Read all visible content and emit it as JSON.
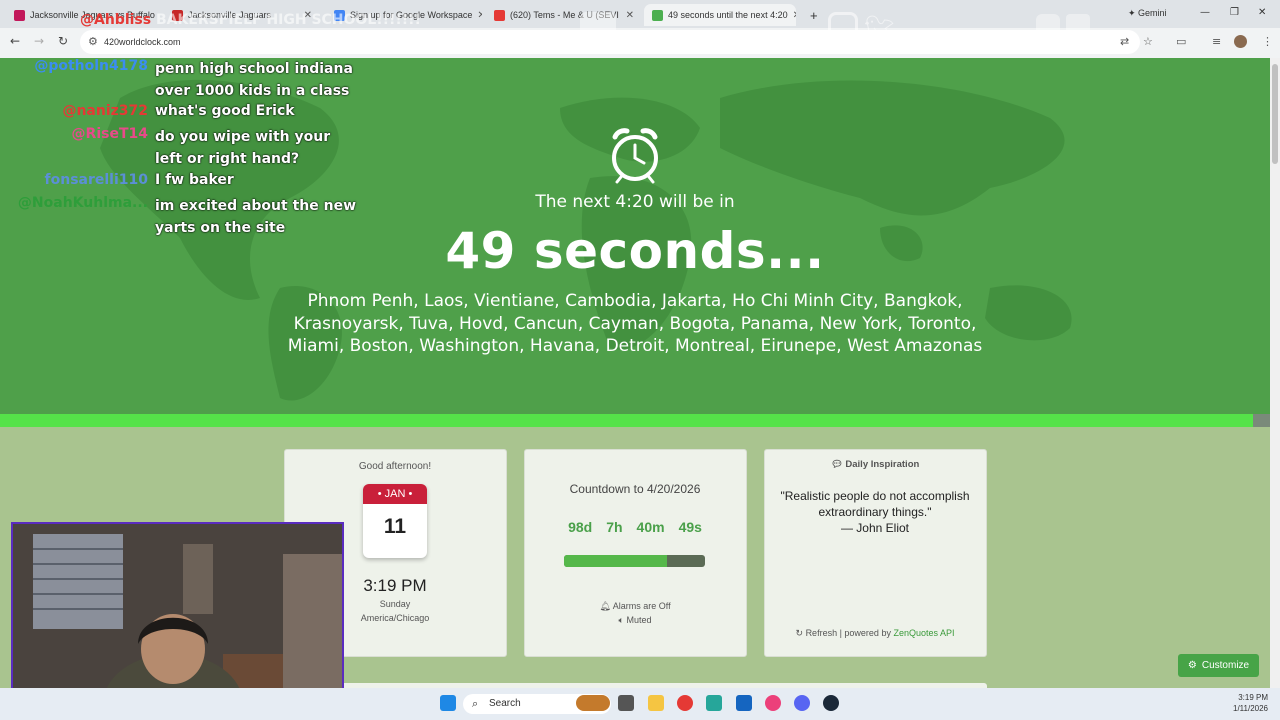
{
  "browser": {
    "tabs": [
      {
        "title": "Jacksonville Jaguars vs Buffalo",
        "color": "#c2185b"
      },
      {
        "title": "Jacksonville Jaguars",
        "color": "#c62828"
      },
      {
        "title": "Sign up for Google Workspace",
        "color": "#4285f4"
      },
      {
        "title": "(620) Tems - Me & U (SEVI",
        "color": "#e53935"
      },
      {
        "title": "49 seconds until the next 4:20",
        "color": "#4caf50"
      }
    ],
    "gemini_label": "Gemini",
    "url": "420worldclock.com"
  },
  "stream_overlay": {
    "banner": "@Ahbliss BAKERSFIELF HIGH SCHOOL!!!!!!!",
    "chat": [
      {
        "user": "@potholn4178",
        "color": "#3b8df0",
        "text": "penn high school indiana over 1000 kids in a class"
      },
      {
        "user": "@naniz372",
        "color": "#e53935",
        "text": "what's good Erick"
      },
      {
        "user": "@RiseT14",
        "color": "#e84a8a",
        "text": "do you wipe with your left or right hand?"
      },
      {
        "user": "fonsarelli110",
        "color": "#5b8fd6",
        "text": "I fw baker"
      },
      {
        "user": "@NoahKuhlma...",
        "color": "#2e9e3a",
        "text": "im excited about the new yarts on the site"
      }
    ]
  },
  "hero": {
    "next_label": "The next 4:20 will be in",
    "countdown": "49 seconds...",
    "cities": "Phnom Penh, Laos, Vientiane, Cambodia, Jakarta, Ho Chi Minh City, Bangkok, Krasnoyarsk, Tuva, Hovd, Cancun, Cayman, Bogota, Panama, New York, Toronto, Miami, Boston, Washington, Havana, Detroit, Montreal, Eirunepe, West Amazonas",
    "progress": 0.987
  },
  "clock_card": {
    "greeting": "Good afternoon!",
    "month": "JAN",
    "day": "11",
    "time": "3:19 PM",
    "weekday": "Sunday",
    "timezone": "America/Chicago"
  },
  "countdown_card": {
    "title": "Countdown to 4/20/2026",
    "days": "98d",
    "hours": "7h",
    "minutes": "40m",
    "seconds": "49s",
    "progress": 0.73,
    "alarms": "Alarms are Off",
    "muted": "Muted"
  },
  "quote_card": {
    "heading": "Daily Inspiration",
    "quote": "\"Realistic people do not accomplish extraordinary things.\"",
    "author": "— John Eliot",
    "refresh": "Refresh",
    "powered_by": " | powered by ",
    "api": "ZenQuotes API"
  },
  "customize_label": "Customize",
  "taskbar": {
    "search": "Search",
    "time": "3:19 PM",
    "date": "1/11/2026"
  }
}
